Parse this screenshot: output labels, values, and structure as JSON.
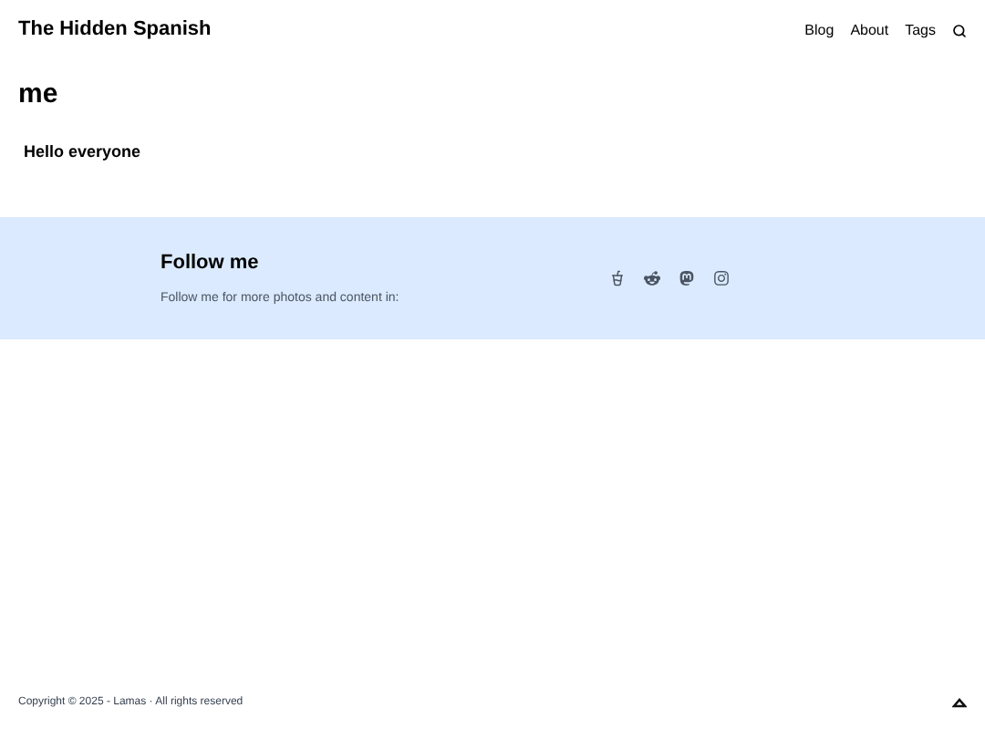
{
  "header": {
    "site_title": "The Hidden Spanish",
    "nav": [
      "Blog",
      "About",
      "Tags"
    ]
  },
  "page": {
    "title": "me",
    "intro": "Hello everyone"
  },
  "follow": {
    "heading": "Follow me",
    "text": "Follow me for more photos and content in:",
    "links": [
      {
        "kind": "cup"
      },
      {
        "kind": "alien"
      },
      {
        "kind": "mastodon"
      },
      {
        "kind": "camera"
      }
    ]
  },
  "footer": {
    "copyright": "Copyright © 2025 - Lamas · All rights reserved"
  }
}
